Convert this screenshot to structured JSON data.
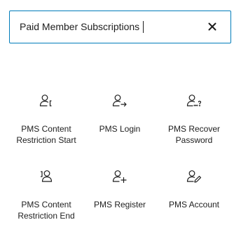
{
  "search": {
    "value": "Paid Member Subscriptions",
    "clear_icon": "close-icon"
  },
  "blocks": [
    {
      "label_line1": "PMS Content",
      "label_line2": "Restriction Start",
      "icon": "user-restriction-start-icon"
    },
    {
      "label_line1": "PMS Login",
      "label_line2": "",
      "icon": "user-login-icon"
    },
    {
      "label_line1": "PMS Recover",
      "label_line2": "Password",
      "icon": "user-recover-password-icon"
    },
    {
      "label_line1": "PMS Content",
      "label_line2": "Restriction End",
      "icon": "user-restriction-end-icon"
    },
    {
      "label_line1": "PMS Register",
      "label_line2": "",
      "icon": "user-register-icon"
    },
    {
      "label_line1": "PMS Account",
      "label_line2": "",
      "icon": "user-account-icon"
    }
  ],
  "colors": {
    "accent": "#007cba",
    "text": "#1e1e1e"
  }
}
